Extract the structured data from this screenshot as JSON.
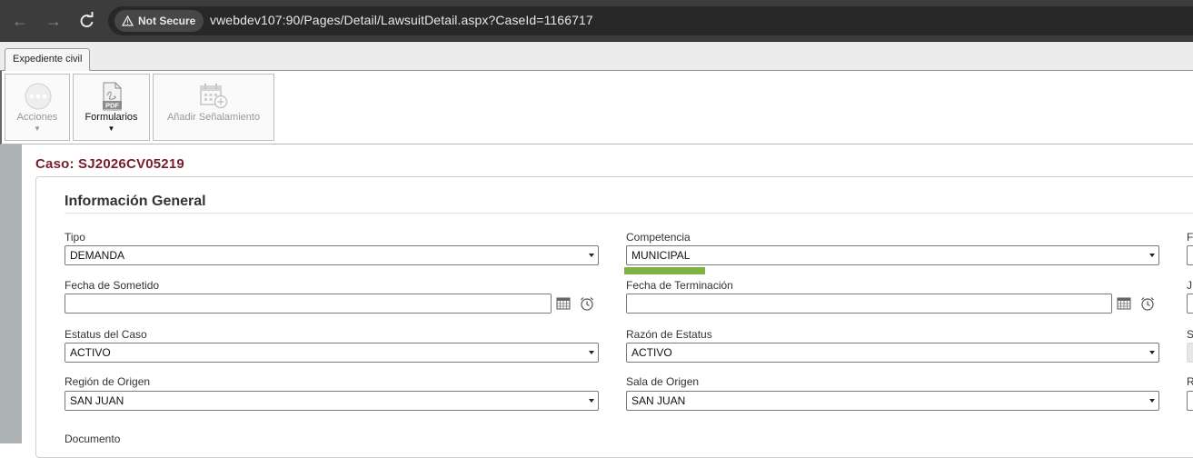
{
  "browser": {
    "security_label": "Not Secure",
    "url": "vwebdev107:90/Pages/Detail/LawsuitDetail.aspx?CaseId=1166717"
  },
  "tabs": [
    {
      "label": "Expediente civil"
    }
  ],
  "toolbar": {
    "acciones": "Acciones",
    "formularios": "Formularios",
    "anadir": "Añadir Señalamiento",
    "pdf_text": "PDF"
  },
  "case": {
    "title": "Caso: SJ2026CV05219"
  },
  "section": {
    "title": "Información General"
  },
  "fields": {
    "tipo": {
      "label": "Tipo",
      "value": "DEMANDA"
    },
    "competencia": {
      "label": "Competencia",
      "value": "MUNICIPAL"
    },
    "fecha_sometido": {
      "label": "Fecha de Sometido",
      "value": ""
    },
    "fecha_terminacion": {
      "label": "Fecha de Terminación",
      "value": ""
    },
    "estatus": {
      "label": "Estatus del Caso",
      "value": "ACTIVO"
    },
    "razon": {
      "label": "Razón de Estatus",
      "value": "ACTIVO"
    },
    "region": {
      "label": "Región de Origen",
      "value": "SAN JUAN"
    },
    "sala": {
      "label": "Sala de Origen",
      "value": "SAN JUAN"
    },
    "documento": {
      "label": "Documento"
    }
  },
  "right_edge_labels": [
    "F",
    "J",
    "S",
    "R"
  ],
  "colors": {
    "case_title": "#7a1c2e",
    "highlight": "#7cb342"
  }
}
